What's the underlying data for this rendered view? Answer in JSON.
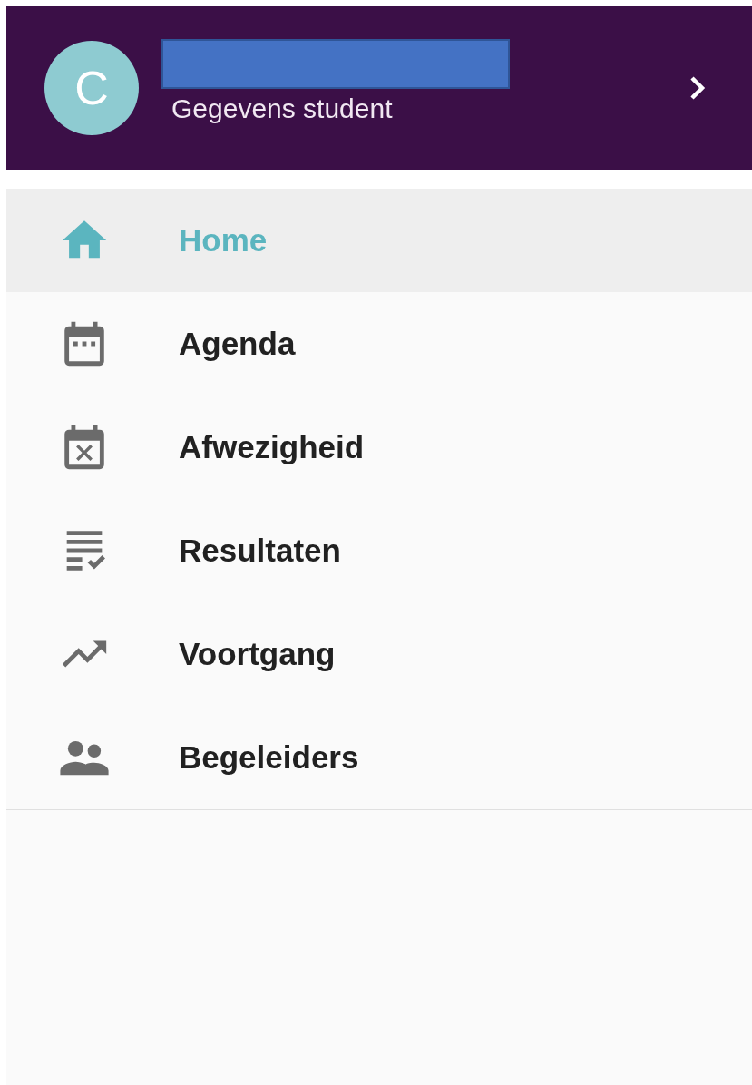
{
  "header": {
    "avatar_initial": "C",
    "subtitle": "Gegevens student"
  },
  "menu": [
    {
      "label": "Home",
      "kind": "home",
      "selected": true
    },
    {
      "label": "Agenda",
      "kind": "calendar",
      "selected": false
    },
    {
      "label": "Afwezigheid",
      "kind": "calendar-x",
      "selected": false
    },
    {
      "label": "Resultaten",
      "kind": "checklist",
      "selected": false
    },
    {
      "label": "Voortgang",
      "kind": "trend",
      "selected": false
    },
    {
      "label": "Begeleiders",
      "kind": "people",
      "selected": false
    }
  ]
}
